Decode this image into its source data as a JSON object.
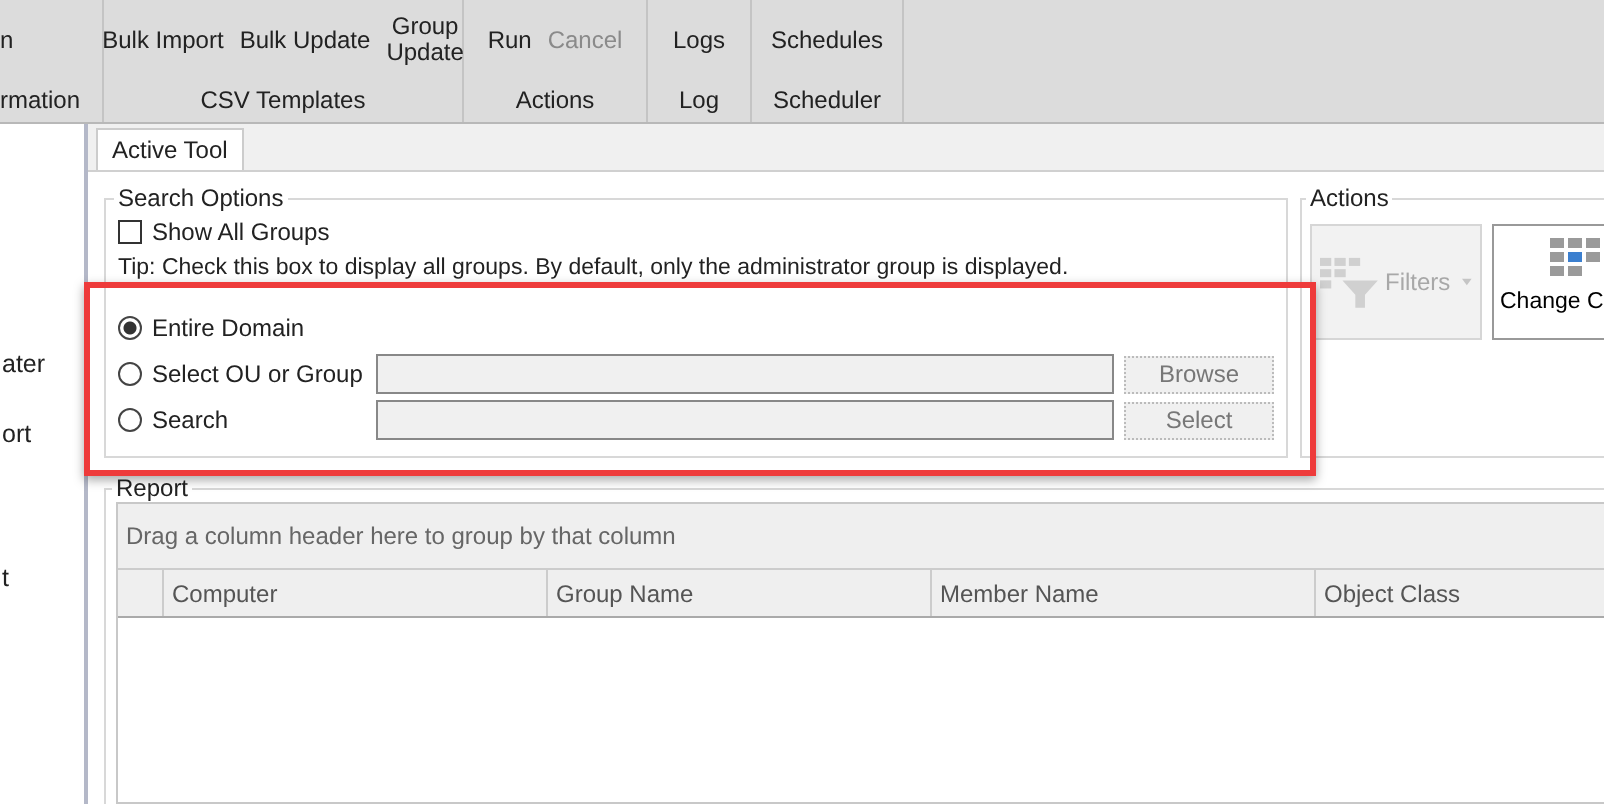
{
  "ribbon": {
    "groups": [
      {
        "caption": "rmation",
        "buttons": [
          {
            "label": "n",
            "disabled": false
          }
        ]
      },
      {
        "caption": "CSV Templates",
        "buttons": [
          {
            "label": "Bulk Import",
            "disabled": false
          },
          {
            "label": "Bulk Update",
            "disabled": false
          },
          {
            "label": "Group Update",
            "disabled": false
          }
        ]
      },
      {
        "caption": "Actions",
        "buttons": [
          {
            "label": "Run",
            "disabled": false
          },
          {
            "label": "Cancel",
            "disabled": true
          }
        ]
      },
      {
        "caption": "Log",
        "buttons": [
          {
            "label": "Logs",
            "disabled": false
          }
        ]
      },
      {
        "caption": "Scheduler",
        "buttons": [
          {
            "label": "Schedules",
            "disabled": false
          }
        ]
      }
    ]
  },
  "sidebar": {
    "items": [
      "ater",
      "ort",
      "t"
    ]
  },
  "tabs": [
    {
      "label": "Active Tool",
      "selected": true
    }
  ],
  "search_options": {
    "title": "Search Options",
    "show_all": {
      "label": "Show All Groups",
      "checked": false
    },
    "tip": "Tip: Check this box to display all groups. By default, only the administrator group is displayed.",
    "scopes": [
      {
        "kind": "plain",
        "label": "Entire Domain",
        "selected": true
      },
      {
        "kind": "field",
        "label": "Select OU or Group",
        "selected": false,
        "button": "Browse"
      },
      {
        "kind": "field",
        "label": "Search",
        "selected": false,
        "button": "Select"
      }
    ]
  },
  "actions": {
    "title": "Actions",
    "buttons": [
      {
        "kind": "filter",
        "label": "Filters",
        "disabled": true
      },
      {
        "kind": "columns",
        "label": "Change C",
        "disabled": false
      }
    ]
  },
  "report": {
    "title": "Report",
    "group_hint": "Drag a column header here to group by that column",
    "columns": [
      "Computer",
      "Group Name",
      "Member Name",
      "Object Class"
    ]
  }
}
